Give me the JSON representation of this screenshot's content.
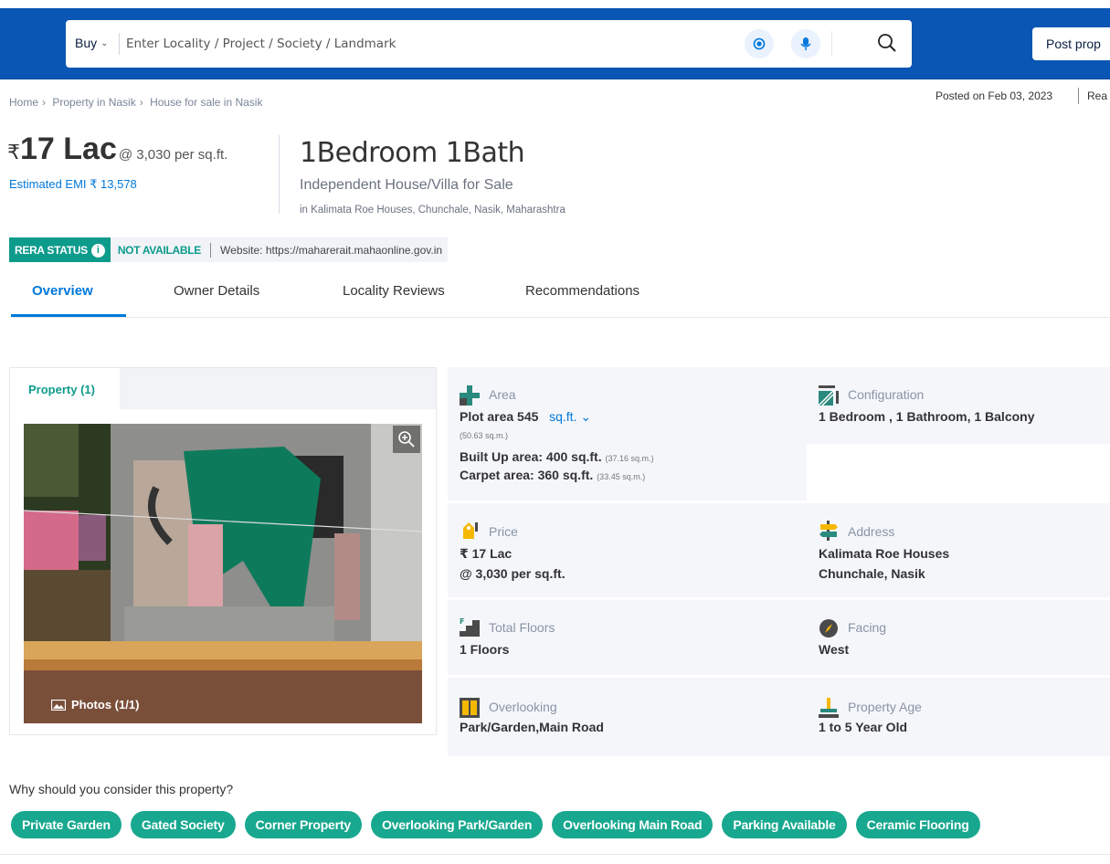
{
  "header": {
    "buy_label": "Buy",
    "search_placeholder": "Enter Locality / Project / Society / Landmark",
    "post_label": "Post prop"
  },
  "breadcrumb": [
    "Home",
    "Property in Nasik",
    "House for sale in Nasik"
  ],
  "posted": {
    "text": "Posted on Feb 03, 2023",
    "more": "Rea"
  },
  "price": {
    "currency": "₹",
    "value": "17 Lac",
    "per_sqft": "@ 3,030 per sq.ft.",
    "emi": "Estimated EMI ₹ 13,578"
  },
  "title": {
    "bhk": "1Bedroom 1Bath",
    "type": "Independent House/Villa for Sale",
    "location": "in Kalimata Roe Houses, Chunchale, Nasik, Maharashtra"
  },
  "rera": {
    "label": "RERA STATUS",
    "status": "NOT AVAILABLE",
    "website": "Website: https://maharerait.mahaonline.gov.in"
  },
  "tabs": [
    "Overview",
    "Owner Details",
    "Locality Reviews",
    "Recommendations"
  ],
  "gallery": {
    "tab": "Property (1)",
    "photos": "Photos (1/1)"
  },
  "details": {
    "area": {
      "label": "Area",
      "plot": "Plot area 545",
      "unit": "sq.ft.",
      "plot_sqm": "(50.63 sq.m.)",
      "built": "Built Up area: 400 sq.ft.",
      "built_sqm": "(37.16 sq.m.)",
      "carpet": "Carpet area: 360 sq.ft.",
      "carpet_sqm": "(33.45 sq.m.)"
    },
    "configuration": {
      "label": "Configuration",
      "value": "1 Bedroom , 1 Bathroom, 1 Balcony"
    },
    "price": {
      "label": "Price",
      "line1": "₹ 17 Lac",
      "line2": "@ 3,030 per sq.ft."
    },
    "address": {
      "label": "Address",
      "line1": "Kalimata Roe Houses",
      "line2": "Chunchale, Nasik"
    },
    "floors": {
      "label": "Total Floors",
      "value": "1 Floors"
    },
    "facing": {
      "label": "Facing",
      "value": "West"
    },
    "overlooking": {
      "label": "Overlooking",
      "value": "Park/Garden,Main Road"
    },
    "age": {
      "label": "Property Age",
      "value": "1 to 5 Year Old"
    }
  },
  "why": {
    "title": "Why should you consider this property?",
    "chips": [
      "Private Garden",
      "Gated Society",
      "Corner Property",
      "Overlooking Park/Garden",
      "Overlooking Main Road",
      "Parking Available",
      "Ceramic Flooring"
    ]
  },
  "colors": {
    "primary": "#0a56b4",
    "accent": "#0078db",
    "teal": "#0d9b8c",
    "chip": "#18a88f"
  },
  "icons": [
    "location-icon",
    "mic-icon",
    "search-icon",
    "zoom-icon",
    "info-icon",
    "area-icon",
    "configuration-icon",
    "price-icon",
    "address-icon",
    "floors-icon",
    "facing-icon",
    "overlooking-icon",
    "age-icon",
    "photos-icon"
  ]
}
